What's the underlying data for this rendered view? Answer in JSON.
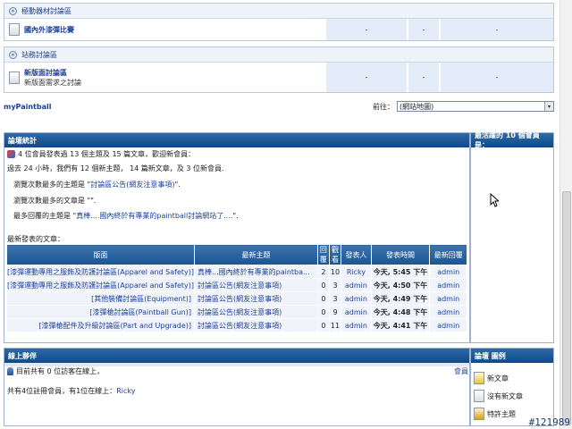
{
  "categories": [
    {
      "title": "極動器材討論區",
      "forums": [
        {
          "title": "國內外漆彈比賽",
          "desc": "",
          "topics": "-",
          "posts": "-",
          "last": "-"
        }
      ]
    },
    {
      "title": "站務討論區",
      "forums": [
        {
          "title": "新版面討論區",
          "desc": "新版面需求之討論",
          "topics": "-",
          "posts": "-",
          "last": "-"
        }
      ]
    }
  ],
  "nav": {
    "site_link": "myPaintball",
    "jump_label": "前往：",
    "jump_selected": "(網站地圖)"
  },
  "stats": {
    "title": "論壇統計",
    "line1": "4 位會員發表過 13 個主題及 15 篇文章，歡迎新會員：",
    "line2": "過去 24 小時，我們有 12 個新主題， 14 篇新文章，及 3 位新會員.",
    "line3_prefix": "瀏覽次數最多的主題是 \"",
    "line3_link": "討論區公告(網友注意事項)",
    "line3_suffix": "\".",
    "line4": "瀏覽次數最多的文章是 \"\".",
    "line5_prefix": "最多回覆的主題是 \"",
    "line5_link": "真棒....國內終於有專業的paintball討論網站了....",
    "line5_suffix": "\".",
    "recent_label": "最新發表的文章："
  },
  "active_members": {
    "title": "最活躍的 10 個會員是："
  },
  "topics_table": {
    "headers": [
      "版面",
      "最新主題",
      "回覆",
      "觀看",
      "發表人",
      "發表時間",
      "最新回覆"
    ],
    "rows": [
      {
        "board": "[漆彈運動專用之服飾及防護討論區(Apparel and Safety)]",
        "topic": "真棒...國內終於有專業的paintba...",
        "replies": "2",
        "views": "10",
        "author": "Ricky",
        "time": "今天, 5:45 下午",
        "last": "admin"
      },
      {
        "board": "[漆彈運動專用之服飾及防護討論區(Apparel and Safety)]",
        "topic": "討論區公告(網友注意事項)",
        "replies": "0",
        "views": "3",
        "author": "admin",
        "time": "今天, 4:50 下午",
        "last": "admin"
      },
      {
        "board": "[其他裝備討論區(Equipment)]",
        "topic": "討論區公告(網友注意事項)",
        "replies": "0",
        "views": "3",
        "author": "admin",
        "time": "今天, 4:49 下午",
        "last": "admin"
      },
      {
        "board": "[漆彈槍討論區(Paintball Gun)]",
        "topic": "討論區公告(網友注意事項)",
        "replies": "0",
        "views": "9",
        "author": "admin",
        "time": "今天, 4:48 下午",
        "last": "admin"
      },
      {
        "board": "[漆彈槍配件及升級討論區(Part and Upgrade)]",
        "topic": "討論區公告(網友注意事項)",
        "replies": "0",
        "views": "11",
        "author": "admin",
        "time": "今天, 4:41 下午",
        "last": "admin"
      }
    ]
  },
  "online": {
    "title": "線上夥伴",
    "guests_line": "目前共有 0 位訪客在線上，",
    "members_link": "會員",
    "registered_line": "共有4位註冊會員，有1位在線上：",
    "online_user": "Ricky"
  },
  "legend": {
    "title": "論壇 圖例",
    "items": [
      "新文章",
      "沒有新文章",
      "特許主題"
    ]
  },
  "watermark": "#121989"
}
